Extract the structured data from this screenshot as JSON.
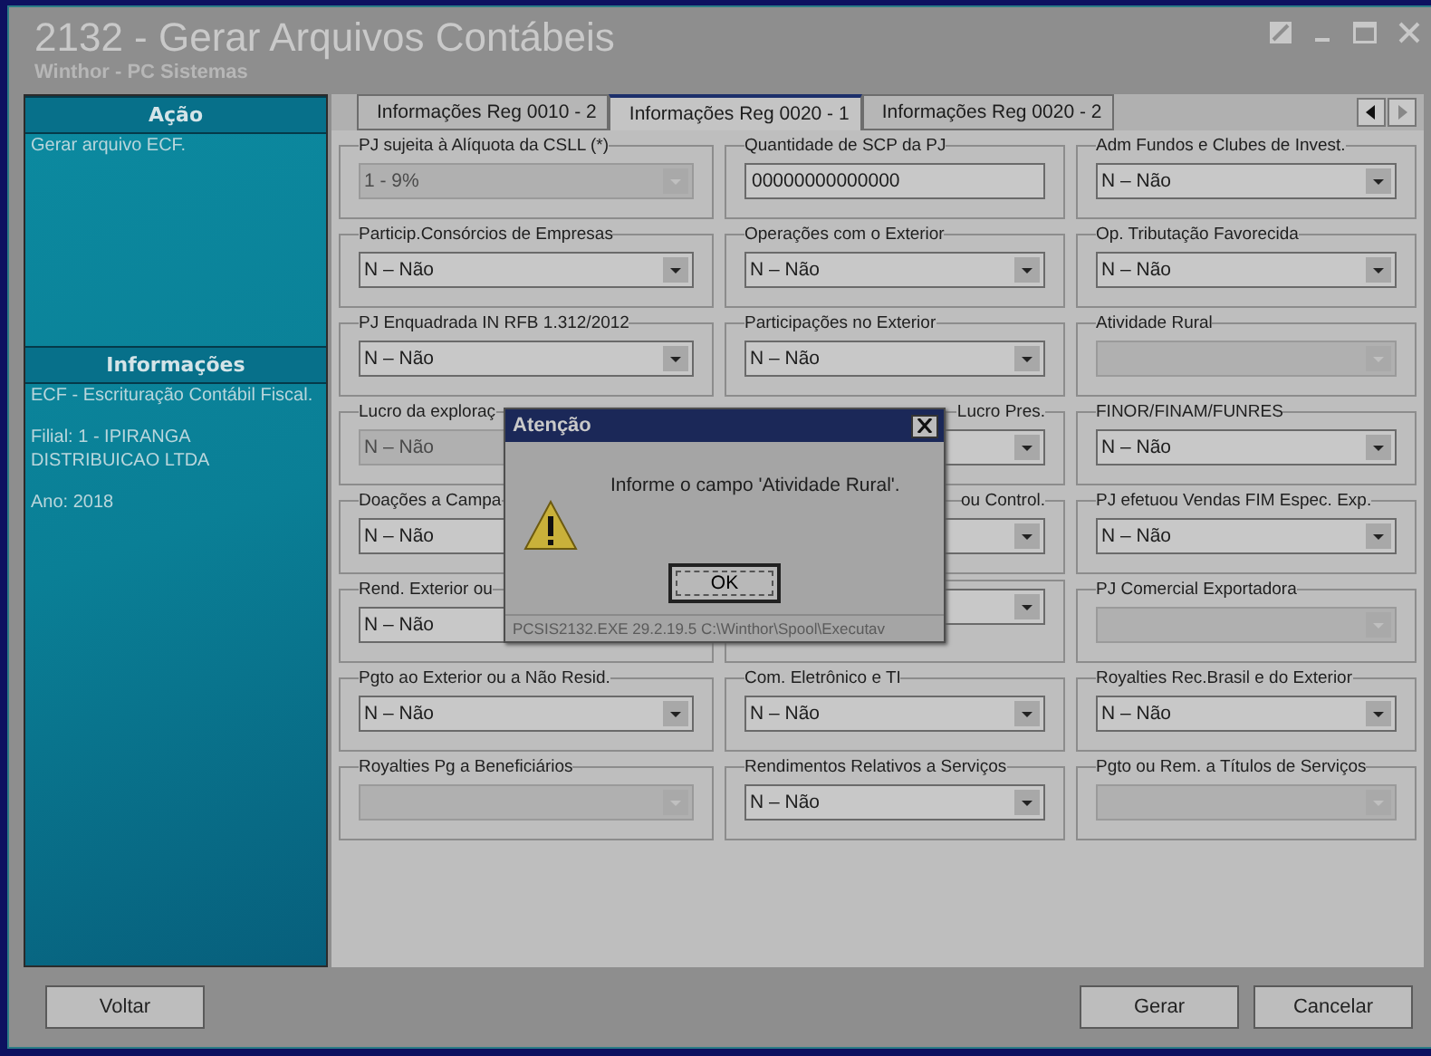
{
  "window": {
    "title": "2132 - Gerar Arquivos Contábeis",
    "subtitle": "Winthor - PC Sistemas"
  },
  "sidebar": {
    "sections": [
      {
        "title": "Ação",
        "lines": [
          "Gerar arquivo ECF."
        ]
      },
      {
        "title": "Informações",
        "lines": [
          "ECF - Escrituração Contábil Fiscal.",
          "Filial: 1 - IPIRANGA DISTRIBUICAO LTDA",
          "Ano: 2018"
        ]
      }
    ]
  },
  "tabs": [
    {
      "label": "Informações Reg 0010 - 2",
      "selected": false
    },
    {
      "label": "Informações Reg 0020 - 1",
      "selected": true
    },
    {
      "label": "Informações Reg 0020 - 2",
      "selected": false
    }
  ],
  "fields": [
    {
      "label": "PJ sujeita à Alíquota da CSLL (*)",
      "kind": "combo",
      "value": "1 - 9%",
      "disabled": true
    },
    {
      "label": "Quantidade de SCP da PJ",
      "kind": "text",
      "value": "00000000000000"
    },
    {
      "label": "Adm Fundos e Clubes de Invest.",
      "kind": "combo",
      "value": "N – Não",
      "disabled": false
    },
    {
      "label": "Particip.Consórcios de Empresas",
      "kind": "combo",
      "value": "N – Não",
      "disabled": false
    },
    {
      "label": "Operações com o Exterior",
      "kind": "combo",
      "value": "N – Não",
      "disabled": false
    },
    {
      "label": "Op. Tributação Favorecida",
      "kind": "combo",
      "value": "N – Não",
      "disabled": false
    },
    {
      "label": "PJ Enquadrada IN RFB 1.312/2012",
      "kind": "combo",
      "value": "N – Não",
      "disabled": false
    },
    {
      "label": "Participações no Exterior",
      "kind": "combo",
      "value": "N – Não",
      "disabled": false
    },
    {
      "label": "Atividade Rural",
      "kind": "combo",
      "disabled": true
    },
    {
      "label": "Lucro da exploraç",
      "kind": "combo",
      "value": "N – Não",
      "disabled": true
    },
    {
      "label": "Lucro Pres.",
      "kind": "combo",
      "disabled": false,
      "clipped": true
    },
    {
      "label": "FINOR/FINAM/FUNRES",
      "kind": "combo",
      "value": "N – Não",
      "disabled": false
    },
    {
      "label": "Doações a Campa",
      "kind": "combo",
      "value": "N – Não",
      "disabled": false
    },
    {
      "label": "ou Control.",
      "kind": "combo",
      "disabled": false,
      "clipped": true
    },
    {
      "label": "PJ efetuou Vendas FIM Espec. Exp.",
      "kind": "combo",
      "value": "N – Não",
      "disabled": false
    },
    {
      "label": "Rend. Exterior ou",
      "kind": "combo",
      "value": "N – Não",
      "disabled": false
    },
    {
      "kind": "combo",
      "disabled": false
    },
    {
      "label": "PJ Comercial Exportadora",
      "kind": "combo",
      "disabled": true
    },
    {
      "label": "Pgto ao Exterior ou a Não Resid.",
      "kind": "combo",
      "value": "N – Não",
      "disabled": false
    },
    {
      "label": "Com. Eletrônico e TI",
      "kind": "combo",
      "value": "N – Não",
      "disabled": false
    },
    {
      "label": "Royalties Rec.Brasil e do Exterior",
      "kind": "combo",
      "value": "N – Não",
      "disabled": false
    },
    {
      "label": "Royalties Pg a Beneficiários",
      "kind": "combo",
      "disabled": true
    },
    {
      "label": "Rendimentos Relativos a Serviços",
      "kind": "combo",
      "value": "N – Não",
      "disabled": false
    },
    {
      "label": "Pgto ou Rem. a Títulos de Serviços",
      "kind": "combo",
      "disabled": true
    }
  ],
  "dialog": {
    "title": "Atenção",
    "message": "Informe o campo 'Atividade Rural'.",
    "button": "OK",
    "footer": "PCSIS2132.EXE 29.2.19.5 C:\\Winthor\\Spool\\Executav"
  },
  "buttons": {
    "left": [
      "Voltar"
    ],
    "right": [
      "Gerar",
      "Cancelar"
    ]
  }
}
